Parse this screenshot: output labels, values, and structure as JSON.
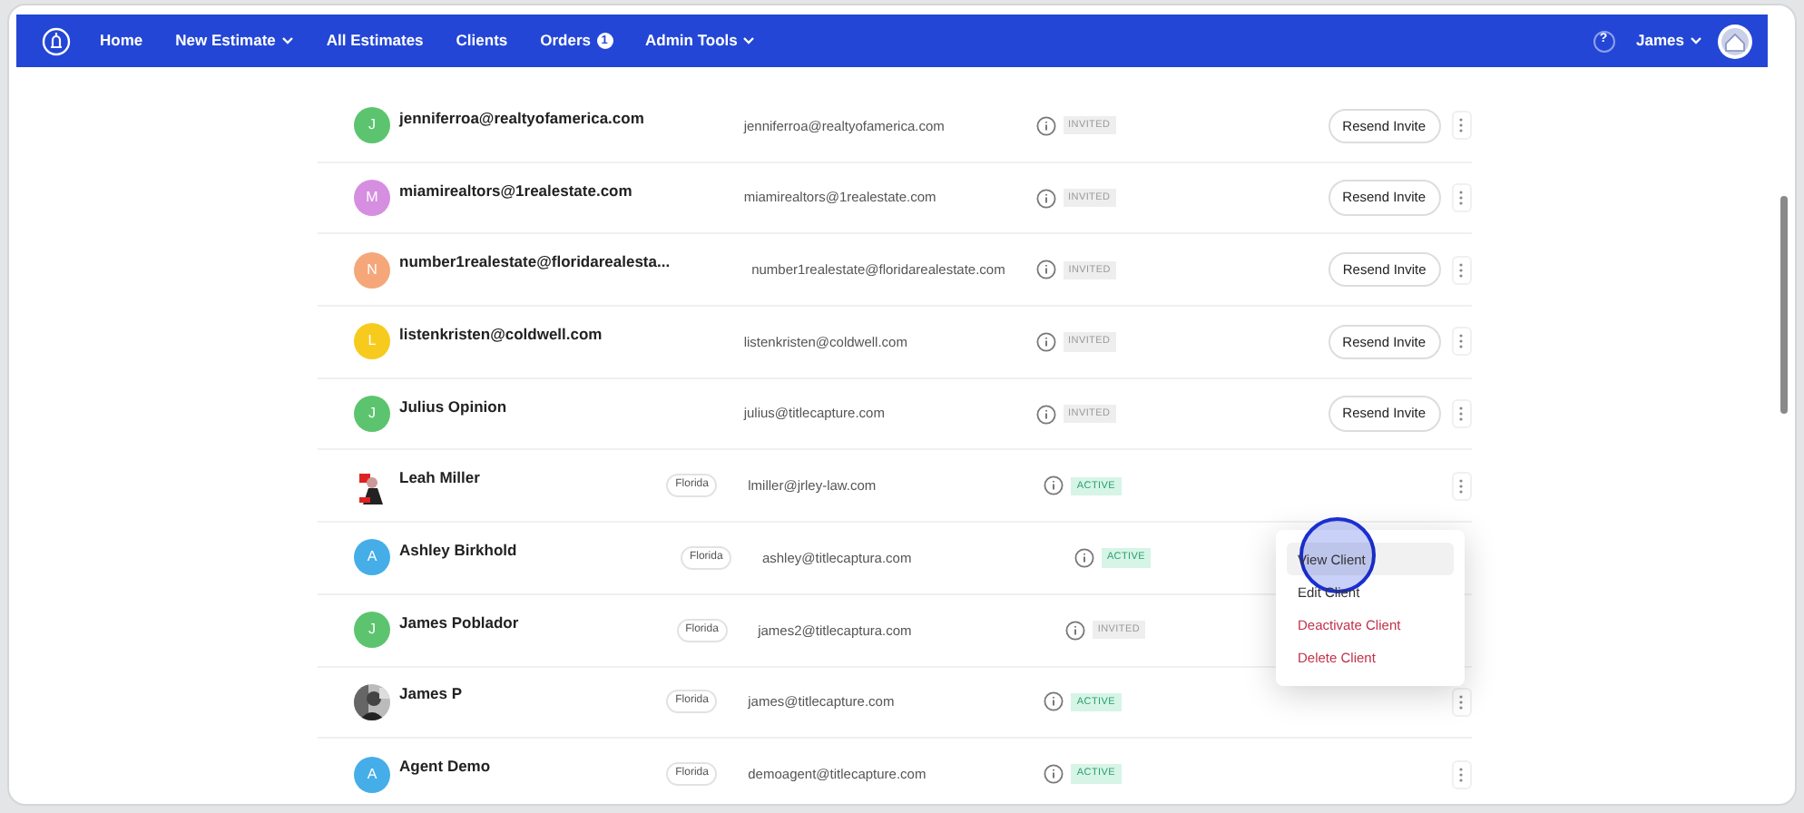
{
  "navbar": {
    "links": [
      {
        "label": "Home",
        "dropdown": false
      },
      {
        "label": "New Estimate",
        "dropdown": true
      },
      {
        "label": "All Estimates",
        "dropdown": false
      },
      {
        "label": "Clients",
        "dropdown": false
      },
      {
        "label": "Orders",
        "dropdown": false,
        "badge": "1"
      },
      {
        "label": "Admin Tools",
        "dropdown": true
      }
    ],
    "help": "?",
    "user": "James"
  },
  "clients": [
    {
      "avatar": {
        "kind": "letter",
        "letter": "J",
        "color": "#5cc46e"
      },
      "name": "jenniferroa@realtyofamerica.com",
      "email": "jenniferroa@realtyofamerica.com",
      "status": "INVITED",
      "kind": "invited",
      "action": "Resend Invite",
      "menu_button": true
    },
    {
      "avatar": {
        "kind": "letter",
        "letter": "M",
        "color": "#d58ee0"
      },
      "name": "miamirealtors@1realestate.com",
      "email": "miamirealtors@1realestate.com",
      "status": "INVITED",
      "kind": "invited",
      "action": "Resend Invite",
      "menu_button": true
    },
    {
      "avatar": {
        "kind": "letter",
        "letter": "N",
        "color": "#f5a77a"
      },
      "name": "number1realestate@floridarealesta...",
      "email": "number1realestate@floridarealestate.com",
      "status": "INVITED",
      "kind": "invited",
      "action": "Resend Invite",
      "menu_button": true
    },
    {
      "avatar": {
        "kind": "letter",
        "letter": "L",
        "color": "#f7cb1d"
      },
      "name": "listenkristen@coldwell.com",
      "email": "listenkristen@coldwell.com",
      "status": "INVITED",
      "kind": "invited",
      "action": "Resend Invite",
      "menu_button": true
    },
    {
      "avatar": {
        "kind": "letter",
        "letter": "J",
        "color": "#5cc46e"
      },
      "name": "Julius Opinion",
      "email": "julius@titlecapture.com",
      "status": "INVITED",
      "kind": "invited",
      "action": "Resend Invite",
      "menu_button": true
    },
    {
      "name": "Leah Miller",
      "region": "Florida",
      "email": "lmiller@jrley-law.com",
      "status": "ACTIVE",
      "kind": "active",
      "menu_button": true
    },
    {
      "avatar": {
        "kind": "letter",
        "letter": "A",
        "color": "#45aee8"
      },
      "name": "Ashley Birkhold",
      "region": "Florida",
      "email": "ashley@titlecaptura.com",
      "status": "ACTIVE",
      "kind": "active",
      "menu_button": false
    },
    {
      "avatar": {
        "kind": "letter",
        "letter": "J",
        "color": "#5cc46e"
      },
      "name": "James Poblador",
      "region": "Florida",
      "email": "james2@titlecaptura.com",
      "status": "INVITED",
      "kind": "invited",
      "menu_button": false
    },
    {
      "name": "James P",
      "region": "Florida",
      "email": "james@titlecapture.com",
      "status": "ACTIVE",
      "kind": "active",
      "menu_button": true
    },
    {
      "avatar": {
        "kind": "letter",
        "letter": "A",
        "color": "#45aee8"
      },
      "name": "Agent Demo",
      "region": "Florida",
      "email": "demoagent@titlecapture.com",
      "status": "ACTIVE",
      "kind": "active",
      "menu_button": true
    }
  ],
  "menu": {
    "items": [
      {
        "label": "View Client",
        "danger": false,
        "selected": true
      },
      {
        "label": "Edit Client",
        "danger": false,
        "selected": false
      },
      {
        "label": "Deactivate Client",
        "danger": true,
        "selected": false
      },
      {
        "label": "Delete Client",
        "danger": true,
        "selected": false
      }
    ]
  }
}
